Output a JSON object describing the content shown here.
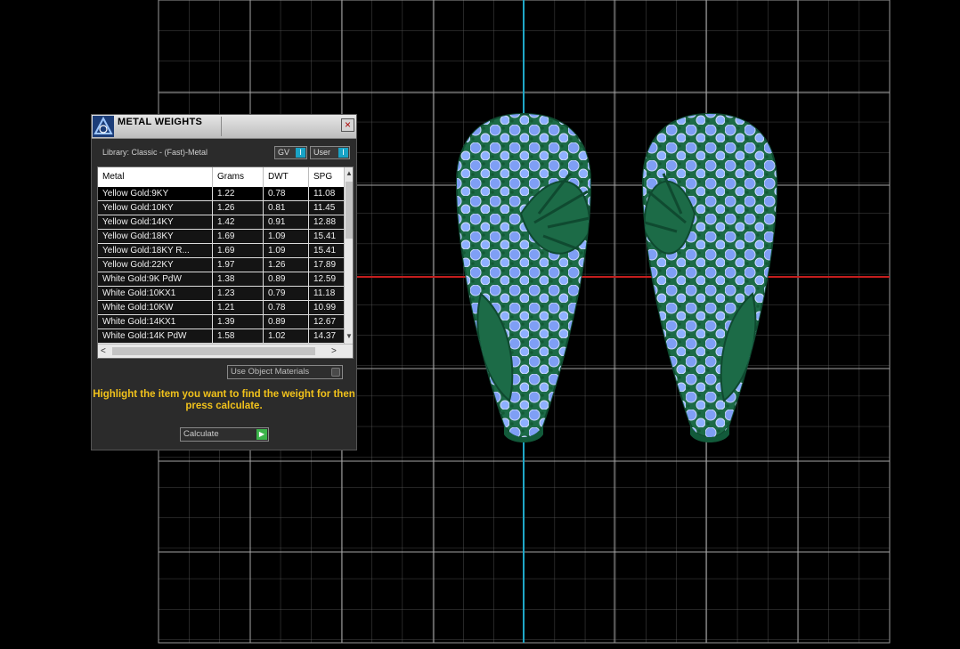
{
  "panel": {
    "title": "METAL WEIGHTS",
    "library_label": "Library: Classic - (Fast)-Metal",
    "toggle_gv": "GV",
    "toggle_user": "User",
    "columns": [
      "Metal",
      "Grams",
      "DWT",
      "SPG"
    ],
    "rows": [
      [
        "Yellow Gold:9KY",
        "1.22",
        "0.78",
        "11.08"
      ],
      [
        "Yellow Gold:10KY",
        "1.26",
        "0.81",
        "11.45"
      ],
      [
        "Yellow Gold:14KY",
        "1.42",
        "0.91",
        "12.88"
      ],
      [
        "Yellow Gold:18KY",
        "1.69",
        "1.09",
        "15.41"
      ],
      [
        "Yellow Gold:18KY R...",
        "1.69",
        "1.09",
        "15.41"
      ],
      [
        "Yellow Gold:22KY",
        "1.97",
        "1.26",
        "17.89"
      ],
      [
        "White Gold:9K PdW",
        "1.38",
        "0.89",
        "12.59"
      ],
      [
        "White Gold:10KX1",
        "1.23",
        "0.79",
        "11.18"
      ],
      [
        "White Gold:10KW",
        "1.21",
        "0.78",
        "10.99"
      ],
      [
        "White Gold:14KX1",
        "1.39",
        "0.89",
        "12.67"
      ],
      [
        "White Gold:14K PdW",
        "1.58",
        "1.02",
        "14.37"
      ]
    ],
    "use_object_materials": "Use Object Materials",
    "instruction": "Highlight the item you want to find the weight for then press calculate.",
    "calculate_label": "Calculate"
  },
  "colors": {
    "background": "#000000",
    "grid": "#8a8a8a",
    "axis_x": "#c41e1e",
    "axis_y": "#1fa7c7",
    "model_green": "#1e6f4a",
    "gem_blue": "#8fb0ff",
    "instruction_yellow": "#f1c21b",
    "toggle_accent": "#19a3c6",
    "calc_green": "#3bb34a"
  },
  "icons": {
    "logo": "app-logo-icon",
    "close": "close-icon",
    "go": "play-arrow-icon"
  }
}
